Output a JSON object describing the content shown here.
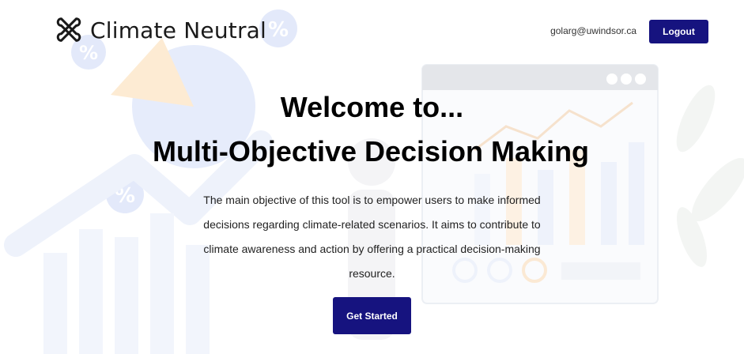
{
  "header": {
    "brand_name": "Climate Neutral",
    "user_email": "golarg@uwindsor.ca",
    "logout_label": "Logout"
  },
  "hero": {
    "title_line1": "Welcome to...",
    "title_line2": "Multi-Objective Decision Making",
    "description": "The main objective of this tool is to empower users to make informed decisions regarding climate-related scenarios. It aims to contribute to climate awareness and action by offering a practical decision-making resource.",
    "cta_label": "Get Started"
  },
  "background": {
    "percent_symbol": "%"
  },
  "colors": {
    "primary": "#16137f",
    "background_blue": "#e8eefb",
    "background_orange": "#fdf0e0"
  },
  "icons": {
    "brand": "interlocked-loops-icon",
    "window_dots": "window-dots-icon",
    "percent_badge": "percent-badge-icon"
  }
}
